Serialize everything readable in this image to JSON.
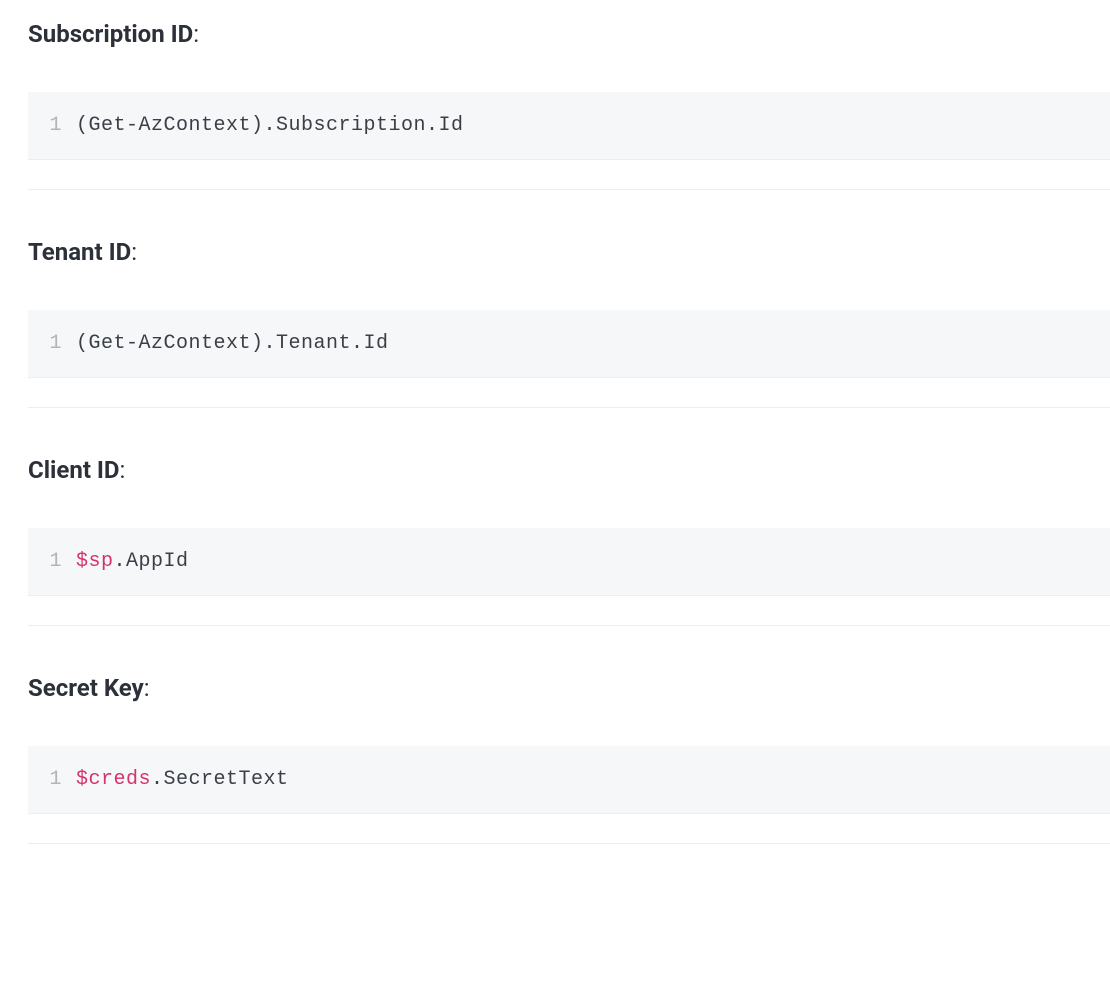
{
  "sections": [
    {
      "label": "Subscription ID",
      "lineno": "1",
      "code_plain": "(Get-AzContext).Subscription.Id",
      "code_var": "",
      "code_tail": ""
    },
    {
      "label": "Tenant ID",
      "lineno": "1",
      "code_plain": "(Get-AzContext).Tenant.Id",
      "code_var": "",
      "code_tail": ""
    },
    {
      "label": "Client ID",
      "lineno": "1",
      "code_plain": "",
      "code_var": "$sp",
      "code_tail": ".AppId"
    },
    {
      "label": "Secret Key",
      "lineno": "1",
      "code_plain": "",
      "code_var": "$creds",
      "code_tail": ".SecretText"
    }
  ],
  "colon": ":"
}
